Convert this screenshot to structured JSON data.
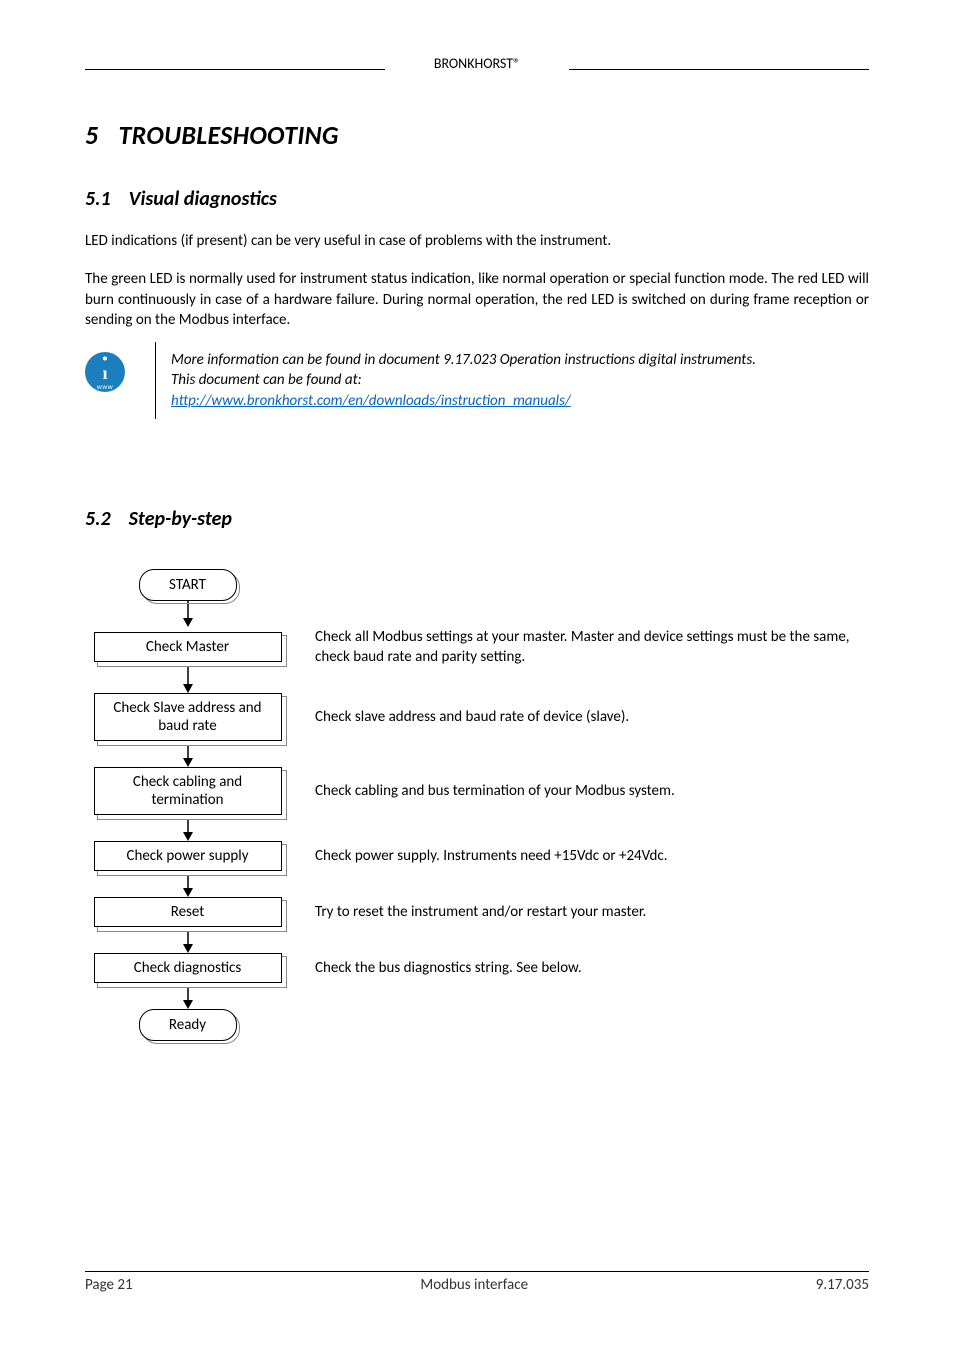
{
  "header": {
    "brand": "BRONKHORST®"
  },
  "chapter": {
    "number": "5",
    "title": "TROUBLESHOOTING"
  },
  "section51": {
    "number": "5.1",
    "title": "Visual diagnostics",
    "p1": "LED indications (if present) can be very useful in case of problems with the instrument.",
    "p2": "The green LED is normally used for instrument status indication, like normal operation or special function mode. The red LED will burn continuously in case of a hardware failure. During normal operation, the red LED is switched on during frame reception or sending on the Modbus interface.",
    "info_line1": "More information can be found in document 9.17.023 Operation instructions digital instruments.",
    "info_line2": "This document can be found at:",
    "info_link": "http://www.bronkhorst.com/en/downloads/instruction_manuals/",
    "info_icon_www": "www"
  },
  "section52": {
    "number": "5.2",
    "title": "Step-by-step",
    "start": "START",
    "ready": "Ready",
    "steps": [
      {
        "box": "Check Master",
        "desc": "Check all Modbus settings at your master. Master and device settings must be the same, check baud rate and parity setting."
      },
      {
        "box": "Check Slave address and baud rate",
        "desc": "Check slave address and baud rate of device (slave)."
      },
      {
        "box": "Check cabling and termination",
        "desc": "Check cabling and bus termination of your Modbus system."
      },
      {
        "box": "Check power supply",
        "desc": "Check power supply. Instruments need +15Vdc or +24Vdc."
      },
      {
        "box": "Reset",
        "desc": "Try to reset the instrument and/or restart your master."
      },
      {
        "box": "Check diagnostics",
        "desc": "Check the bus diagnostics string. See below."
      }
    ]
  },
  "footer": {
    "page": "Page 21",
    "center": "Modbus interface",
    "code": "9.17.035"
  }
}
